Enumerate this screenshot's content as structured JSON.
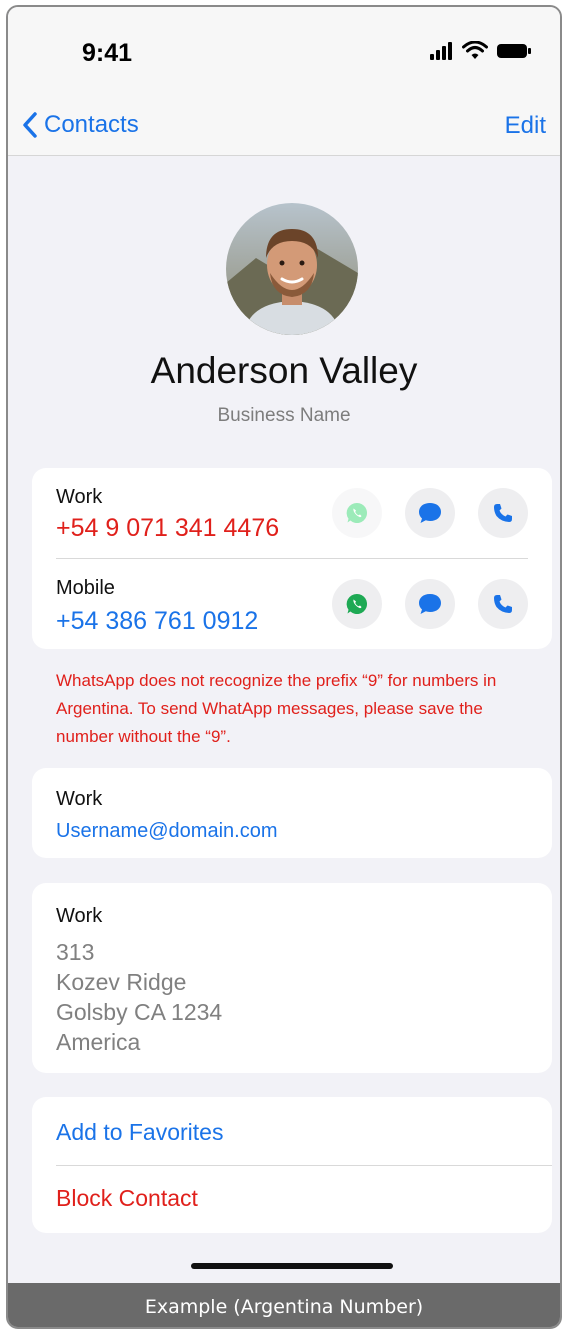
{
  "status_bar": {
    "time": "9:41"
  },
  "nav": {
    "back_label": "Contacts",
    "edit_label": "Edit"
  },
  "contact": {
    "name": "Anderson Valley",
    "business": "Business Name"
  },
  "phones": [
    {
      "label": "Work",
      "number": "+54 9 071 341 4476",
      "number_color": "#e0201b",
      "whatsapp_available": false
    },
    {
      "label": "Mobile",
      "number": "+54 386 761 0912",
      "number_color": "#1a73e8",
      "whatsapp_available": true
    }
  ],
  "warning": "WhatsApp does not recognize the prefix “9” for numbers in Argentina. To send WhatApp messages, please save the number without the “9”.",
  "email": {
    "label": "Work",
    "value": "Username@domain.com"
  },
  "address": {
    "label": "Work",
    "lines": [
      "313",
      "Kozev Ridge",
      "Golsby CA 1234",
      "America"
    ]
  },
  "actions": {
    "favorites": "Add to Favorites",
    "block": "Block Contact"
  },
  "caption": "Example (Argentina Number)",
  "colors": {
    "accent": "#1a73e8",
    "danger": "#e0201b",
    "whatsapp": "#25d366"
  }
}
